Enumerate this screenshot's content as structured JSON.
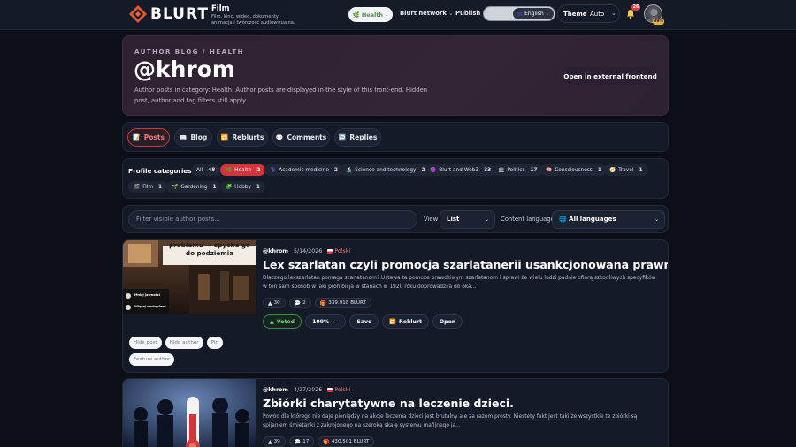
{
  "brand": {
    "logo_text": "BLURT",
    "title": "Film",
    "subtitle": "Film, kino, wideo, dokumenty, animacja i twórczość audiowizualna."
  },
  "topbar": {
    "health_label": "Health",
    "blurt_network_label": "Blurt network",
    "publish_label": "Publish",
    "language_value": "English",
    "theme_label": "Theme",
    "theme_value": "Auto",
    "notifications_count": "26",
    "avatar_badge": "99%"
  },
  "header": {
    "breadcrumb": "AUTHOR BLOG / HEALTH",
    "handle": "@khrom",
    "description": "Author posts in category: Health. Author posts are displayed in the style of this front-end. Hidden post, author and tag filters still apply.",
    "external_button": "Open in external frontend"
  },
  "tabs": [
    {
      "label": "Posts",
      "icon": "📝"
    },
    {
      "label": "Blog",
      "icon": "📖"
    },
    {
      "label": "Reblurts",
      "icon": "🔁"
    },
    {
      "label": "Comments",
      "icon": "💬"
    },
    {
      "label": "Replies",
      "icon": "↩️"
    }
  ],
  "categories": {
    "title": "Profile categories:",
    "items": [
      {
        "label": "All",
        "count": "48",
        "icon": ""
      },
      {
        "label": "Health",
        "count": "2",
        "icon": "🌿"
      },
      {
        "label": "Academic medicine",
        "count": "2",
        "icon": "⚕️"
      },
      {
        "label": "Science and technology",
        "count": "2",
        "icon": "🔬"
      },
      {
        "label": "Blurt and Web3",
        "count": "33",
        "icon": "🟣"
      },
      {
        "label": "Politics",
        "count": "17",
        "icon": "🏛"
      },
      {
        "label": "Consciousness",
        "count": "1",
        "icon": "🧠"
      },
      {
        "label": "Travel",
        "count": "1",
        "icon": "🧭"
      },
      {
        "label": "Film",
        "count": "1",
        "icon": "🎬"
      },
      {
        "label": "Gardening",
        "count": "1",
        "icon": "🌱"
      },
      {
        "label": "Hobby",
        "count": "1",
        "icon": "🧩"
      }
    ]
  },
  "filter": {
    "placeholder": "Filter visible author posts...",
    "view_label": "View",
    "view_value": "List",
    "content_language_label": "Content language",
    "content_language_value": "All languages"
  },
  "posts": [
    {
      "author": "@khrom",
      "date": "5/14/2026",
      "language": "Polski",
      "title": "Lex szarlatan czyli promocja szarlatanerii usankcjonowana prawnie.",
      "excerpt": "Dlaczego lexszarlatan pomaga szarlatanom? Ustawa ta pomoże prawdziwym szarlatanom i sprawi że wielu ludzi padnie ofiarą szkodliwych specyfików w ten sam sposób w jaki prohibicja w stanach w 1920 roku doprowadziła do oka...",
      "votes": "30",
      "comments": "2",
      "payout": "339.918 BLURT",
      "thumb_headline": "problemu — spycha go do podziemia",
      "thumb_label_1": "Mniej jawności",
      "thumb_label_2": "Więcej nastąpieru",
      "actions": {
        "voted": "Voted",
        "weight": "100%",
        "save": "Save",
        "reblurt": "Reblurt",
        "open": "Open"
      },
      "moderation": [
        "Hide post",
        "Hide author",
        "Pin",
        "Feature author"
      ]
    },
    {
      "author": "@khrom",
      "date": "4/27/2026",
      "language": "Polski",
      "title": "Zbiórki charytatywne na leczenie dzieci.",
      "excerpt": "Powód dla którego nie daje pieniędzy na akcje leczenia dzieci jest brutalny ale za razem prosty. Niestety fakt jest taki że wszystkie te zbiórki są spijaniem śmietanki z zakrojonego na szeroką skalę systemu mafijnego ja...",
      "votes": "39",
      "comments": "17",
      "payout": "430.501 BLURT"
    }
  ],
  "colors": {
    "accent": "#d4343b",
    "background": "#0c0f18",
    "card": "#141a28",
    "header_card": "#2f2333",
    "voted": "#6fd07e"
  }
}
